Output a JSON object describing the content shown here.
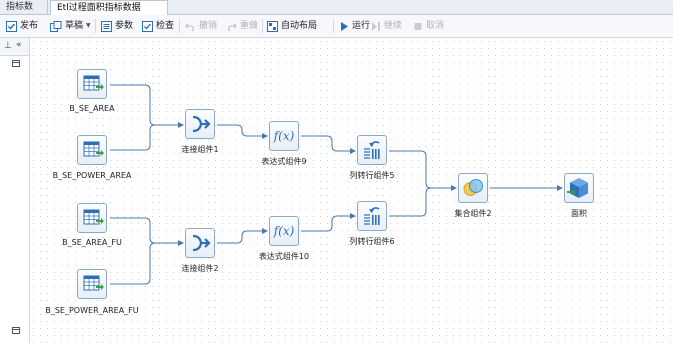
{
  "tabs": [
    {
      "label": "指标数据",
      "active": false
    },
    {
      "label": "Etl过程面积指标数据",
      "active": true
    }
  ],
  "toolbar": {
    "publish": "发布",
    "draft": "草稿",
    "params": "参数",
    "check": "检查",
    "undo": "撤销",
    "redo": "重做",
    "auto_layout": "自动布局",
    "run": "运行",
    "continue": "继续",
    "cancel": "取消"
  },
  "nodes": {
    "b_se_area": "B_SE_AREA",
    "b_se_power_area": "B_SE_POWER_AREA",
    "b_se_area_fu": "B_SE_AREA_FU",
    "b_se_power_area_fu": "B_SE_POWER_AREA_FU",
    "join1": "连接组件1",
    "join2": "连接组件2",
    "expr9": "表达式组件9",
    "expr10": "表达式组件10",
    "col2row5": "列转行组件5",
    "col2row6": "列转行组件6",
    "union2": "集合组件2",
    "output": "面积"
  },
  "colors": {
    "accent": "#2f6db5",
    "wire": "#4c78a8",
    "green": "#3aa23a"
  }
}
